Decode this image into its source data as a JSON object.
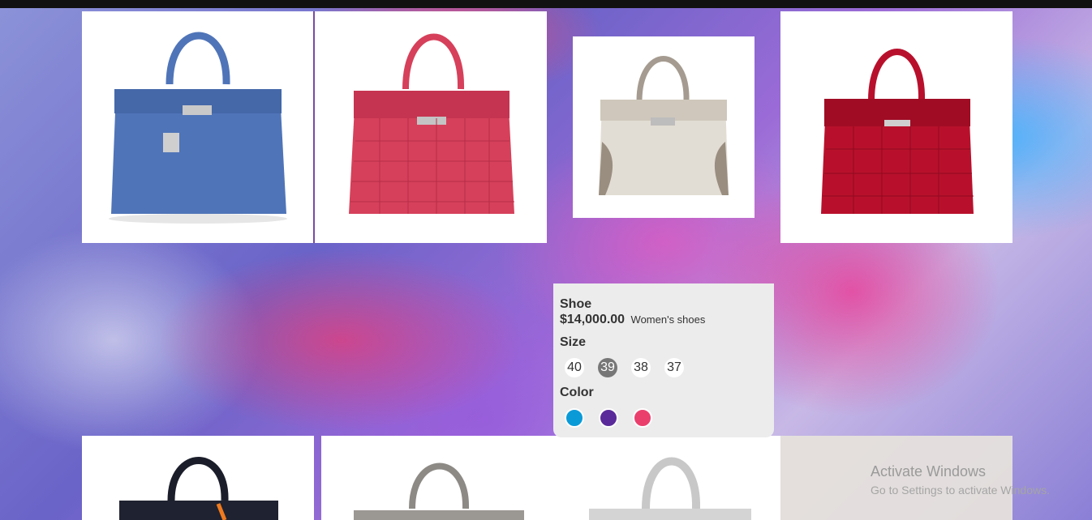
{
  "products": [
    {
      "name": "blue-bag",
      "color": "#4f74b8"
    },
    {
      "name": "pink-croc-bag",
      "color": "#d6405a"
    },
    {
      "name": "himalaya-bag",
      "color": "#d8d2c8"
    },
    {
      "name": "red-croc-bag",
      "color": "#b8102c"
    },
    {
      "name": "black-croc-bag",
      "color": "#1b1e2a"
    },
    {
      "name": "grey-lizard-bag",
      "color": "#8d8a86"
    },
    {
      "name": "silver-bag",
      "color": "#c8c8c8"
    }
  ],
  "detail": {
    "title": "Shoe",
    "price": "$14,000.00",
    "category": "Women's shoes",
    "size_label": "Size",
    "sizes": [
      "40",
      "39",
      "38",
      "37"
    ],
    "selected_size": "39",
    "color_label": "Color",
    "colors": [
      "#0a9ad8",
      "#5a2a9a",
      "#ea3f6d"
    ]
  },
  "watermark": {
    "title": "Activate Windows",
    "subtitle": "Go to Settings to activate Windows."
  }
}
